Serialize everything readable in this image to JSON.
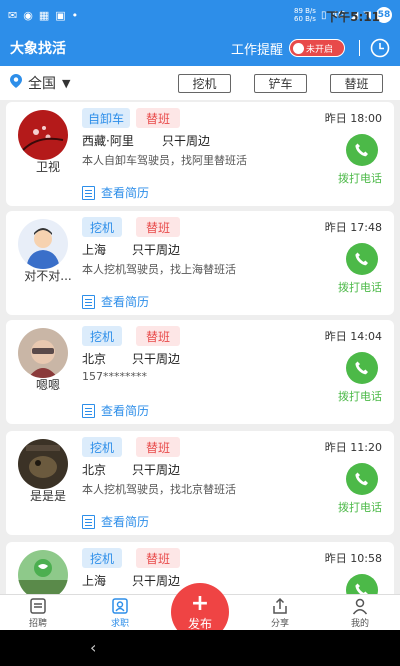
{
  "status": {
    "time": "下午5:11",
    "net_speed_up": "89 B/s",
    "net_speed_down": "60 B/s",
    "network": "4G",
    "battery": "58"
  },
  "app": {
    "title": "大象找活",
    "work_reminder": "工作提醒",
    "toggle_state": "未开启"
  },
  "filter": {
    "region": "全国",
    "buttons": [
      "挖机",
      "铲车",
      "替班"
    ]
  },
  "call_label": "拨打电话",
  "resume_label": "查看简历",
  "cards": [
    {
      "name": "卫视",
      "tags": [
        "自卸车",
        "替班"
      ],
      "location": "西藏·阿里",
      "scope": "只干周边",
      "desc": "本人自卸车驾驶员，找阿里替班活",
      "time": "昨日 18:00"
    },
    {
      "name": "对不对...",
      "tags": [
        "挖机",
        "替班"
      ],
      "location": "上海",
      "scope": "只干周边",
      "desc": "本人挖机驾驶员，找上海替班活",
      "time": "昨日 17:48"
    },
    {
      "name": "嗯嗯",
      "tags": [
        "挖机",
        "替班"
      ],
      "location": "北京",
      "scope": "只干周边",
      "desc": "157********",
      "time": "昨日 14:04"
    },
    {
      "name": "是是是",
      "tags": [
        "挖机",
        "替班"
      ],
      "location": "北京",
      "scope": "只干周边",
      "desc": "本人挖机驾驶员，找北京替班活",
      "time": "昨日 11:20"
    },
    {
      "name": "",
      "tags": [
        "挖机",
        "替班"
      ],
      "location": "上海",
      "scope": "只干周边",
      "desc": "",
      "time": "昨日 10:58"
    }
  ],
  "tabs": {
    "recruit": "招聘",
    "jobseek": "求职",
    "publish": "发布",
    "share": "分享",
    "mine": "我的"
  },
  "colors": {
    "primary": "#2d8ee9",
    "accent_red": "#e84a4a",
    "call_green": "#4cb948"
  }
}
